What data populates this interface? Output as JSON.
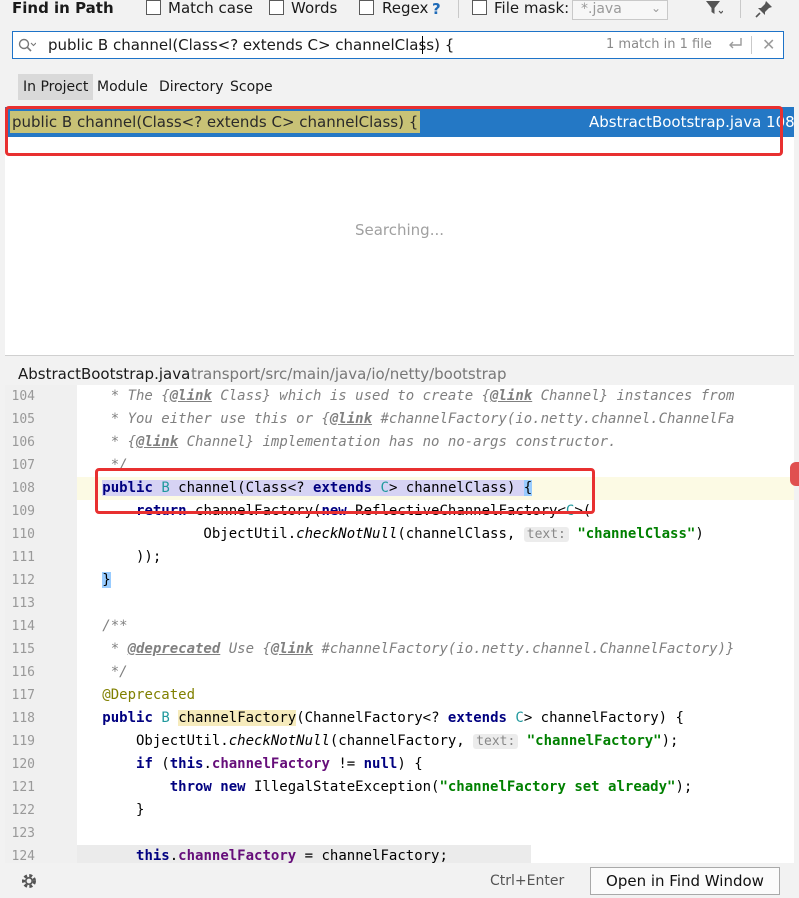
{
  "header": {
    "title": "Find in Path",
    "match_case": "Match case",
    "words": "Words",
    "regex": "Regex",
    "regex_help": "?",
    "file_mask": "File mask:",
    "file_mask_value": "*.java"
  },
  "search": {
    "query": "public B channel(Class<? extends C> channelClass) {",
    "match_count": "1 match in 1 file"
  },
  "scope_tabs": [
    "In Project",
    "Module",
    "Directory",
    "Scope"
  ],
  "result": {
    "text": "public B channel(Class<? extends C> channelClass) {",
    "file": "AbstractBootstrap.java 108"
  },
  "searching_text": "Searching...",
  "preview": {
    "filename": "AbstractBootstrap.java",
    "path": "transport/src/main/java/io/netty/bootstrap"
  },
  "code": {
    "line_numbers": [
      "104",
      "105",
      "106",
      "107",
      "108",
      "109",
      "110",
      "111",
      "112",
      "113",
      "114",
      "115",
      "116",
      "117",
      "118",
      "119",
      "120",
      "121",
      "122",
      "123",
      "124"
    ],
    "hint_text": "text:"
  },
  "footer": {
    "shortcut": "Ctrl+Enter",
    "open_button": "Open in Find Window"
  },
  "colors": {
    "selection": "#2478c5",
    "highlight": "#c8c276",
    "annotation_box": "#e83030"
  }
}
